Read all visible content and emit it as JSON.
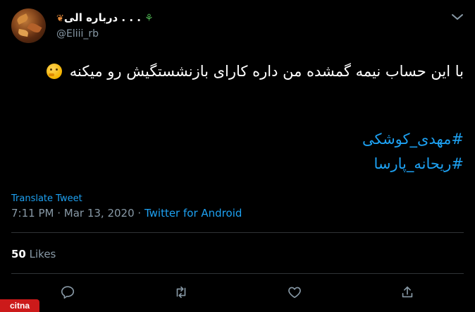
{
  "user": {
    "display_name": "درباره الی . . .",
    "handle": "@Eliii_rb"
  },
  "tweet": {
    "text": "با این حساب نیمه گمشده من داره کارای بازنشستگیش رو میکنه",
    "emoji": "thinking-face-emoji",
    "hashtags": [
      "#مهدی_کوشکی",
      "#ریحانه_پارسا"
    ]
  },
  "translate_label": "Translate Tweet",
  "meta": {
    "time": "7:11 PM",
    "separator": " · ",
    "date": "Mar 13, 2020",
    "source": "Twitter for Android"
  },
  "likes": {
    "count": "50",
    "label": "Likes"
  },
  "actions": [
    "reply-icon",
    "retweet-icon",
    "like-icon",
    "share-icon"
  ],
  "watermark": "citna",
  "colors": {
    "background": "#000000",
    "accent": "#1da1f2",
    "secondary_text": "#8899a6",
    "divider": "#2f3336"
  }
}
